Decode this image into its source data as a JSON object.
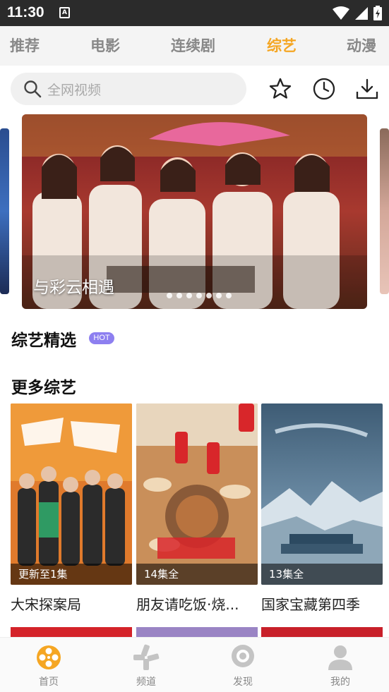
{
  "status_bar": {
    "time": "11:30",
    "notification_letter": "A"
  },
  "tabs": [
    {
      "label": "推荐",
      "active": false
    },
    {
      "label": "电影",
      "active": false
    },
    {
      "label": "连续剧",
      "active": false
    },
    {
      "label": "综艺",
      "active": true
    },
    {
      "label": "动漫",
      "active": false
    }
  ],
  "search": {
    "placeholder": "全网视频"
  },
  "banner": {
    "caption": "与彩云相遇",
    "page_count": 7
  },
  "sections": {
    "featured": {
      "title": "综艺精选",
      "badge": "HOT"
    },
    "more": {
      "title": "更多综艺"
    }
  },
  "cards": [
    {
      "title": "大宋探案局",
      "badge": "更新至1集"
    },
    {
      "title": "朋友请吃饭·烧...",
      "badge": "14集全"
    },
    {
      "title": "国家宝藏第四季",
      "badge": "13集全"
    }
  ],
  "bottom_nav": [
    {
      "label": "首页",
      "icon": "film-reel-icon",
      "active": true
    },
    {
      "label": "频道",
      "icon": "channel-icon",
      "active": false
    },
    {
      "label": "发现",
      "icon": "discover-icon",
      "active": false
    },
    {
      "label": "我的",
      "icon": "profile-icon",
      "active": false
    }
  ],
  "colors": {
    "accent": "#f5a623",
    "hot_badge": "#8d7ff0",
    "inactive_tab": "#888888"
  }
}
